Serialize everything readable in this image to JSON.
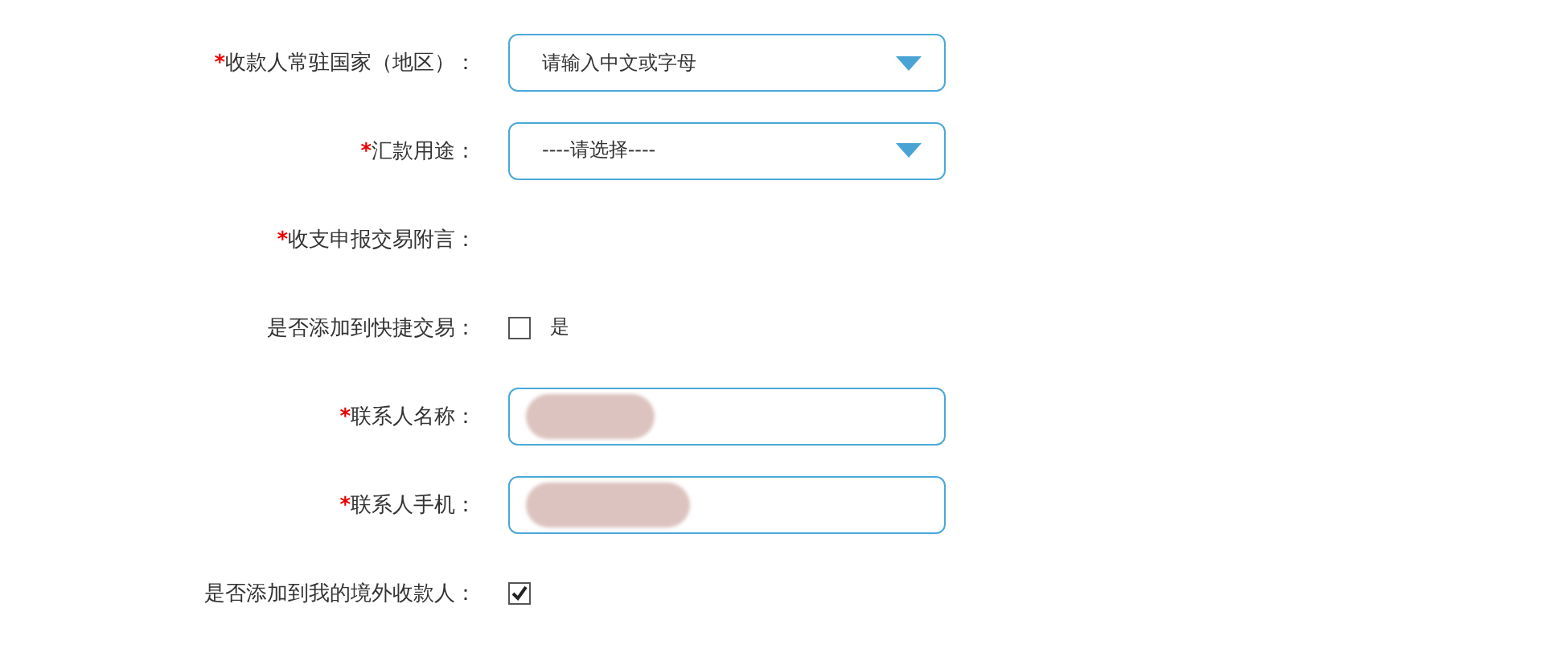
{
  "form": {
    "rows": [
      {
        "kind": "select",
        "mark": "*",
        "label": "收款人常驻国家（地区）：",
        "placeholder": "请输入中文或字母"
      },
      {
        "kind": "select",
        "mark": "*",
        "label": "汇款用途：",
        "value": "----请选择----"
      },
      {
        "kind": "static",
        "mark": "*",
        "label": "收支申报交易附言："
      },
      {
        "kind": "checkbox",
        "label": "是否添加到快捷交易：",
        "checked": false,
        "option": "是"
      },
      {
        "kind": "input",
        "mark": "*",
        "label": "联系人名称：",
        "redacted": true
      },
      {
        "kind": "input",
        "mark": "*",
        "label": "联系人手机：",
        "redacted": true
      },
      {
        "kind": "checkbox",
        "label": "是否添加到我的境外收款人：",
        "checked": true
      }
    ]
  }
}
